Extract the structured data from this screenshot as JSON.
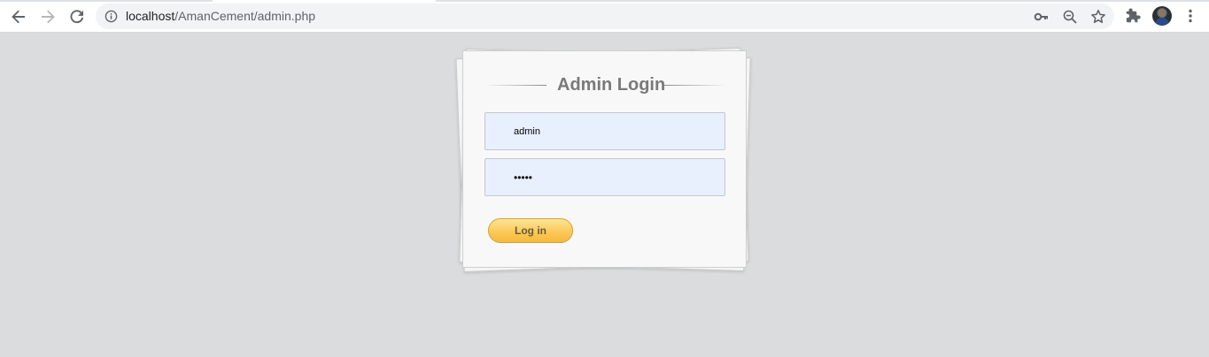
{
  "browser": {
    "url_host": "localhost",
    "url_path": "/AmanCement/admin.php"
  },
  "icons": {
    "back": "back-arrow-icon",
    "forward": "forward-arrow-icon",
    "reload": "reload-icon",
    "site_info": "info-icon",
    "key": "key-icon",
    "zoom": "zoom-out-icon",
    "bookmark": "star-icon",
    "extensions": "puzzle-icon",
    "menu": "kebab-menu-icon"
  },
  "login": {
    "title": "Admin Login",
    "username_value": "admin",
    "password_value": "•••••",
    "submit_label": "Log in"
  },
  "colors": {
    "page_background": "#dbdcdd",
    "card_background": "#f8f8f8",
    "autofill_field": "#e8f0fe",
    "button_gradient_top": "#fde49a",
    "button_gradient_bottom": "#f7b93a",
    "title_text": "#7a7a7a"
  }
}
